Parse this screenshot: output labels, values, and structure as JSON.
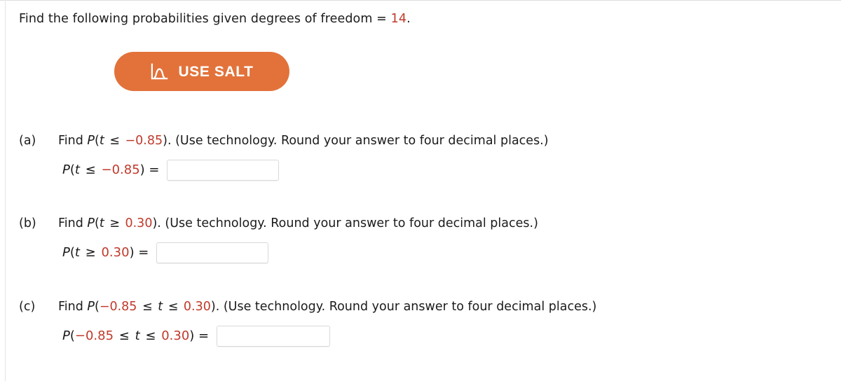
{
  "prompt": {
    "lead": "Find the following probabilities given degrees of freedom = ",
    "df": "14",
    "period": "."
  },
  "salt_button": {
    "label": "USE SALT",
    "icon": "distribution-curve-icon",
    "background_color": "#e2723a",
    "text_color": "#ffffff"
  },
  "colors": {
    "value_red": "#c0392b",
    "text": "#1b1b1b",
    "input_border": "#d9d9d9"
  },
  "parts": [
    {
      "marker": "(a)",
      "find_word": "Find ",
      "q_p": "P",
      "q_open": "(",
      "q_var": "t",
      "q_rel": " ≤ ",
      "q_value": "−0.85",
      "q_close": ")",
      "q_tail": ". (Use technology. Round your answer to four decimal places.)",
      "answer_label_p": "P",
      "answer_label_open": "(",
      "answer_label_var": "t",
      "answer_label_rel": " ≤ ",
      "answer_label_value": "−0.85",
      "answer_label_close": ") =",
      "answer_value": "",
      "answer_placeholder": ""
    },
    {
      "marker": "(b)",
      "find_word": "Find ",
      "q_p": "P",
      "q_open": "(",
      "q_var": "t",
      "q_rel": " ≥ ",
      "q_value": "0.30",
      "q_close": ")",
      "q_tail": ". (Use technology. Round your answer to four decimal places.)",
      "answer_label_p": "P",
      "answer_label_open": "(",
      "answer_label_var": "t",
      "answer_label_rel": " ≥ ",
      "answer_label_value": "0.30",
      "answer_label_close": ") =",
      "answer_value": "",
      "answer_placeholder": ""
    },
    {
      "marker": "(c)",
      "find_word": "Find ",
      "q_p": "P",
      "q_open": "(",
      "q_value_low": "−0.85",
      "q_rel_low": " ≤ ",
      "q_var": "t",
      "q_rel_high": " ≤ ",
      "q_value_high": "0.30",
      "q_close": ")",
      "q_tail": ". (Use technology. Round your answer to four decimal places.)",
      "answer_label_p": "P",
      "answer_label_open": "(",
      "answer_label_value_low": "−0.85",
      "answer_label_rel_low": " ≤ ",
      "answer_label_var": "t",
      "answer_label_rel_high": " ≤ ",
      "answer_label_value_high": "0.30",
      "answer_label_close": ") =",
      "answer_value": "",
      "answer_placeholder": ""
    }
  ]
}
